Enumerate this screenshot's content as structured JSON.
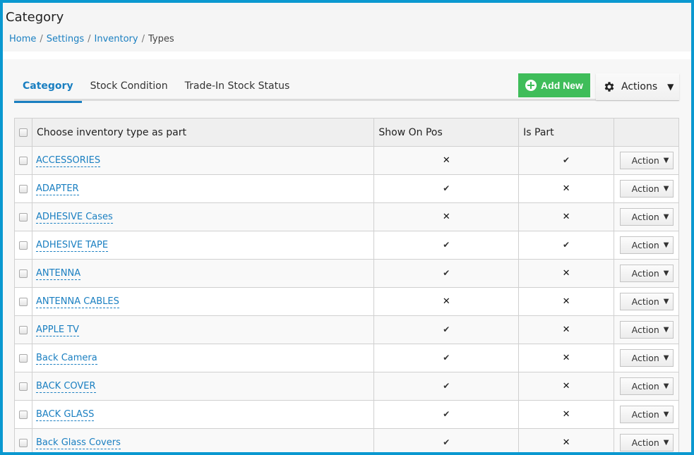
{
  "page": {
    "title": "Category",
    "breadcrumb": [
      {
        "label": "Home",
        "link": true
      },
      {
        "label": "Settings",
        "link": true
      },
      {
        "label": "Inventory",
        "link": true
      },
      {
        "label": "Types",
        "link": false
      }
    ],
    "breadcrumb_separator": "/"
  },
  "tabs": [
    {
      "label": "Category",
      "active": true
    },
    {
      "label": "Stock Condition",
      "active": false
    },
    {
      "label": "Trade-In Stock Status",
      "active": false
    }
  ],
  "toolbar": {
    "add_new_label": "Add New",
    "add_new_icon": "plus-circle-icon",
    "actions_label": "Actions",
    "actions_icon": "gear-icon",
    "caret": "▼"
  },
  "colors": {
    "accent": "#1a7fc1",
    "add_button": "#3fbd5a",
    "frame_border": "#0a98d0"
  },
  "table": {
    "columns": [
      "",
      "Choose inventory type as part",
      "Show On Pos",
      "Is Part",
      ""
    ],
    "action_label": "Action",
    "check_symbol": "✔",
    "x_symbol": "✕",
    "rows": [
      {
        "name": "ACCESSORIES",
        "show_on_pos": false,
        "is_part": true
      },
      {
        "name": "ADAPTER",
        "show_on_pos": true,
        "is_part": false
      },
      {
        "name": "ADHESIVE Cases",
        "show_on_pos": false,
        "is_part": false
      },
      {
        "name": "ADHESIVE TAPE",
        "show_on_pos": true,
        "is_part": true
      },
      {
        "name": "ANTENNA",
        "show_on_pos": true,
        "is_part": false
      },
      {
        "name": "ANTENNA CABLES",
        "show_on_pos": false,
        "is_part": false
      },
      {
        "name": "APPLE TV",
        "show_on_pos": true,
        "is_part": false
      },
      {
        "name": "Back Camera",
        "show_on_pos": true,
        "is_part": false
      },
      {
        "name": "BACK COVER",
        "show_on_pos": true,
        "is_part": false
      },
      {
        "name": "BACK GLASS",
        "show_on_pos": true,
        "is_part": false
      },
      {
        "name": "Back Glass Covers",
        "show_on_pos": true,
        "is_part": false
      }
    ]
  }
}
